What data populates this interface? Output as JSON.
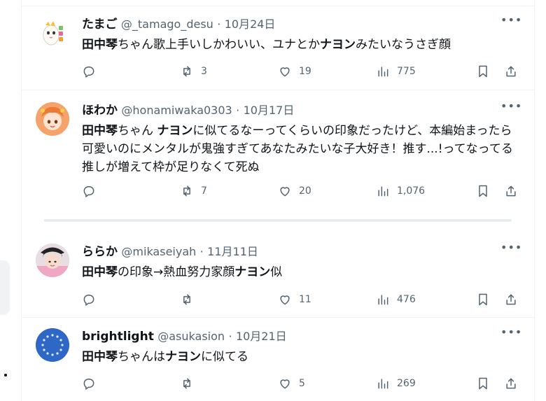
{
  "tweets": [
    {
      "display_name": "たまご",
      "handle": "@_tamago_desu",
      "sep": "·",
      "date": "10月24日",
      "text_parts": [
        {
          "b": true,
          "t": "田中琴"
        },
        {
          "b": false,
          "t": "ちゃん歌上手いしかわいい、ユナとか"
        },
        {
          "b": true,
          "t": "ナヨン"
        },
        {
          "b": false,
          "t": "みたいなうさぎ顔"
        }
      ],
      "replies": "",
      "retweets": "3",
      "likes": "19",
      "views": "775",
      "avatar_icon": "egg-character-icon"
    },
    {
      "display_name": "ほわか",
      "handle": "@honamiwaka0303",
      "sep": "·",
      "date": "10月17日",
      "text_parts": [
        {
          "b": true,
          "t": "田中琴"
        },
        {
          "b": false,
          "t": "ちゃん "
        },
        {
          "b": true,
          "t": "ナヨン"
        },
        {
          "b": false,
          "t": "に似てるなーってくらいの印象だったけど、本編始まったら可愛いのにメンタルが鬼強すぎてあなたみたいな子大好き！推す...!ってなってる 推しが増えて枠が足りなくて死ぬ"
        }
      ],
      "replies": "",
      "retweets": "7",
      "likes": "20",
      "views": "1,076",
      "avatar_icon": "orange-hair-girl-icon"
    },
    {
      "display_name": "ららか",
      "handle": "@mikaseiyah",
      "sep": "·",
      "date": "11月11日",
      "text_parts": [
        {
          "b": true,
          "t": "田中琴"
        },
        {
          "b": false,
          "t": "の印象→熱血努力家顔"
        },
        {
          "b": true,
          "t": "ナヨン"
        },
        {
          "b": false,
          "t": "似"
        }
      ],
      "replies": "",
      "retweets": "",
      "likes": "11",
      "views": "476",
      "avatar_icon": "photo-avatar-icon"
    },
    {
      "display_name": "brightlight",
      "handle": "@asukasion",
      "sep": "·",
      "date": "10月21日",
      "text_parts": [
        {
          "b": true,
          "t": "田中琴"
        },
        {
          "b": false,
          "t": "ちゃんは"
        },
        {
          "b": true,
          "t": "ナヨン"
        },
        {
          "b": false,
          "t": "に似てる"
        }
      ],
      "replies": "",
      "retweets": "",
      "likes": "5",
      "views": "269",
      "avatar_icon": "eu-stars-icon"
    }
  ],
  "colors": {
    "text": "#0f1419",
    "secondary": "#536471",
    "border": "#eff3f4"
  }
}
